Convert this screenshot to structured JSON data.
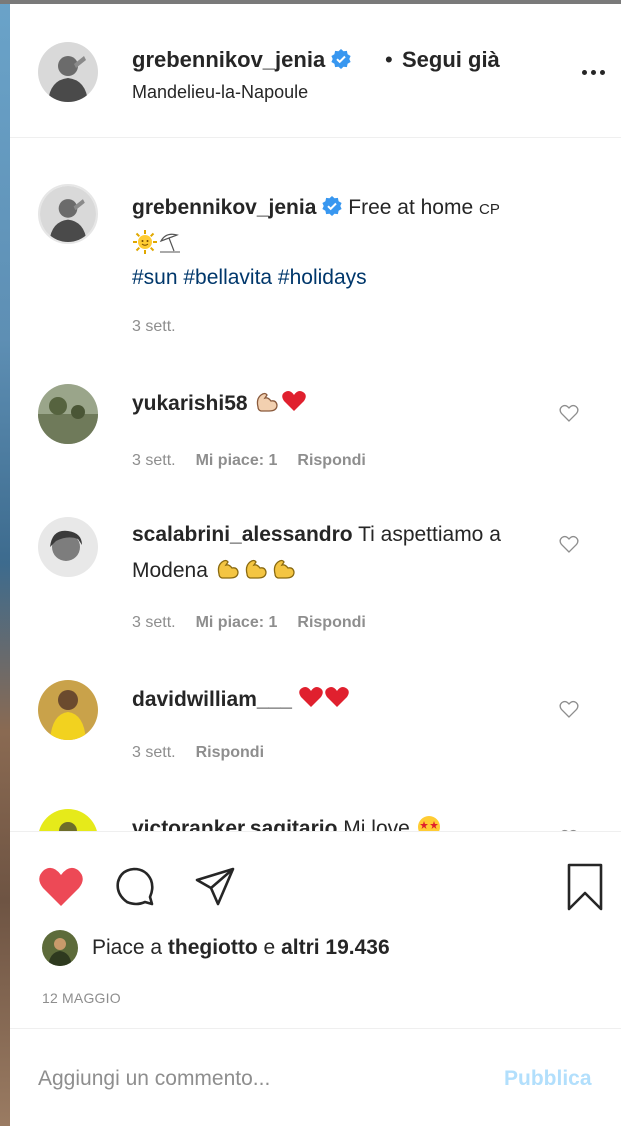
{
  "post": {
    "username": "grebennikov_jenia",
    "separator": "•",
    "follow_status": "Segui già",
    "location": "Mandelieu-la-Napoule"
  },
  "caption": {
    "username": "grebennikov_jenia",
    "text": "Free at home",
    "suffix": "CP",
    "hashtags": "#sun #bellavita #holidays",
    "time": "3 sett."
  },
  "comments": [
    {
      "username": "yukarishi58",
      "text": "",
      "time": "3 sett.",
      "likes": "Mi piace: 1",
      "reply": "Rispondi"
    },
    {
      "username": "scalabrini_alessandro",
      "text": "Ti aspettiamo a Modena",
      "time": "3 sett.",
      "likes": "Mi piace: 1",
      "reply": "Rispondi"
    },
    {
      "username": "davidwilliam___",
      "text": "",
      "time": "3 sett.",
      "reply": "Rispondi"
    },
    {
      "username": "victoranker.sagitario",
      "text": "Mi love"
    }
  ],
  "likes": {
    "prefix": "Piace a",
    "user": "thegiotto",
    "middle": "e",
    "others": "altri 19.436"
  },
  "date": "12 MAGGIO",
  "add_comment": {
    "placeholder": "Aggiungi un commento...",
    "publish": "Pubblica"
  },
  "colors": {
    "like_red": "#ed4956",
    "verified_blue": "#3897f0",
    "hashtag": "#00376b",
    "secondary_text": "#8e8e8e",
    "publish_disabled": "#b2dffc"
  },
  "icons": [
    "more-options-icon",
    "verified-icon",
    "heart-icon",
    "comment-icon",
    "share-icon",
    "bookmark-icon"
  ]
}
